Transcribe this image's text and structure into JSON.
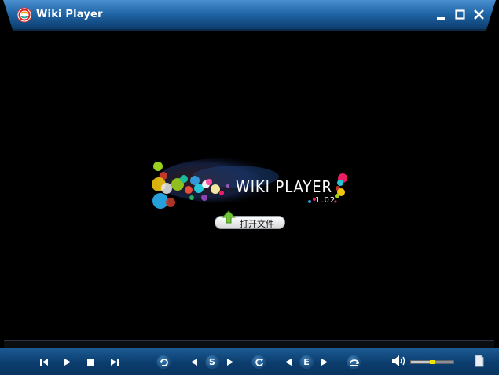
{
  "window": {
    "title": "Wiki Player"
  },
  "titlebar": {
    "controls": [
      {
        "name": "minimize-button",
        "icon": "minimize-icon"
      },
      {
        "name": "maximize-button",
        "icon": "maximize-icon"
      },
      {
        "name": "close-button",
        "icon": "close-icon"
      }
    ]
  },
  "splash": {
    "logo_text": "WIKI PLAYER",
    "version": "1.02",
    "open_file_label": "打开文件"
  },
  "controls": {
    "prev": {
      "icon": "skip-previous-icon"
    },
    "play": {
      "icon": "play-icon"
    },
    "stop": {
      "icon": "stop-icon"
    },
    "next": {
      "icon": "skip-next-icon"
    },
    "rewind": {
      "icon": "rewind-icon"
    },
    "start_point": {
      "label": "S",
      "icon": "set-start-icon"
    },
    "repeat": {
      "icon": "repeat-icon"
    },
    "end_point": {
      "label": "E",
      "icon": "set-end-icon"
    },
    "ab_loop": {
      "icon": "loop-icon"
    },
    "volume": {
      "icon": "speaker-icon",
      "level": 0.5
    },
    "playlist": {
      "icon": "document-icon"
    }
  },
  "colors": {
    "titlebar_top": "#3a7fc0",
    "titlebar_bottom": "#0b3d6d",
    "controlbar": "#0b3d6d",
    "accent_yellow": "#f2e500"
  }
}
